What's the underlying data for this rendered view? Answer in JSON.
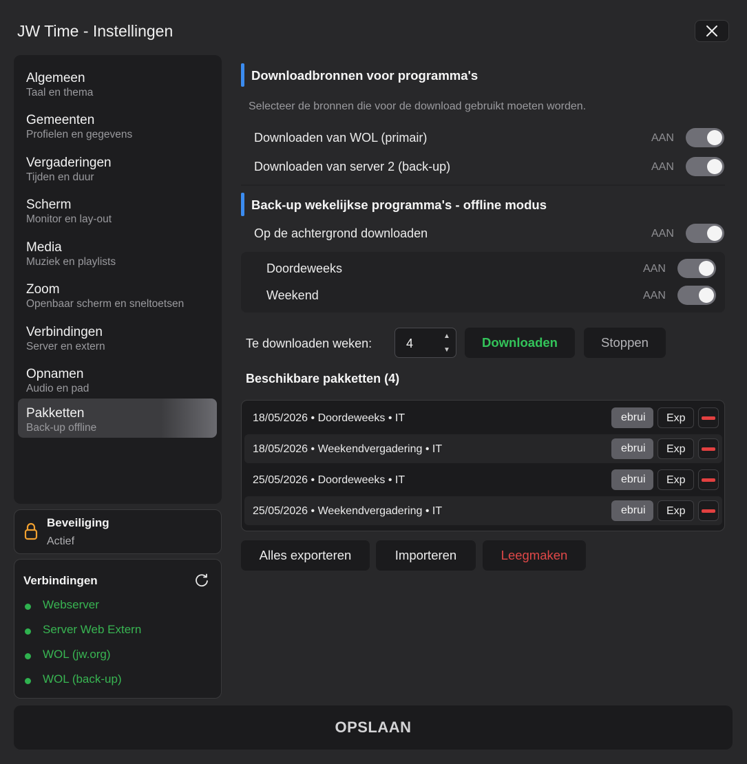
{
  "window": {
    "title": "JW Time - Instellingen",
    "close_icon": "close-icon"
  },
  "sidebar": {
    "items": [
      {
        "label": "Algemeen",
        "sub": "Taal en thema"
      },
      {
        "label": "Gemeenten",
        "sub": "Profielen en gegevens"
      },
      {
        "label": "Vergaderingen",
        "sub": "Tijden en duur"
      },
      {
        "label": "Scherm",
        "sub": "Monitor en lay-out"
      },
      {
        "label": "Media",
        "sub": "Muziek en playlists"
      },
      {
        "label": "Zoom",
        "sub": "Openbaar scherm en sneltoetsen"
      },
      {
        "label": "Verbindingen",
        "sub": "Server en extern"
      },
      {
        "label": "Opnamen",
        "sub": "Audio en pad"
      },
      {
        "label": "Pakketten",
        "sub": "Back-up offline",
        "active": true
      }
    ]
  },
  "security": {
    "title": "Beveiliging",
    "status": "Actief",
    "icon": "lock-icon"
  },
  "connections": {
    "title": "Verbindingen",
    "refresh_icon": "refresh-icon",
    "items": [
      {
        "label": "Webserver",
        "status_color": "#2fb24f"
      },
      {
        "label": "Server Web Extern",
        "status_color": "#2fb24f"
      },
      {
        "label": "WOL (jw.org)",
        "status_color": "#2fb24f"
      },
      {
        "label": "WOL (back-up)",
        "status_color": "#2fb24f"
      }
    ]
  },
  "main": {
    "sources": {
      "title": "Downloadbronnen voor programma's",
      "description": "Selecteer de bronnen die voor de download gebruikt moeten worden.",
      "rows": [
        {
          "label": "Downloaden van WOL (primair)",
          "state": "AAN",
          "on": true
        },
        {
          "label": "Downloaden van server 2 (back-up)",
          "state": "AAN",
          "on": true
        }
      ]
    },
    "offline": {
      "title": "Back-up wekelijkse programma's - offline modus",
      "background": {
        "label": "Op de achtergrond downloaden",
        "state": "AAN",
        "on": true
      },
      "sub_rows": [
        {
          "label": "Doordeweeks",
          "state": "AAN",
          "on": true
        },
        {
          "label": "Weekend",
          "state": "AAN",
          "on": true
        }
      ]
    },
    "download": {
      "weeks_label": "Te downloaden weken:",
      "weeks_value": "4",
      "download_label": "Downloaden",
      "stop_label": "Stoppen"
    },
    "packages": {
      "title": "Beschikbare pakketten (4)",
      "use_label": "ebrui",
      "export_label": "Exp",
      "rows": [
        {
          "text": "18/05/2026 • Doordeweeks • IT"
        },
        {
          "text": "18/05/2026 • Weekendvergadering • IT"
        },
        {
          "text": "25/05/2026 • Doordeweeks • IT"
        },
        {
          "text": "25/05/2026 • Weekendvergadering • IT"
        }
      ]
    },
    "actions": {
      "export_all": "Alles exporteren",
      "import": "Importeren",
      "clear": "Leegmaken"
    }
  },
  "footer": {
    "save_label": "OPSLAAN"
  },
  "colors": {
    "accent": "#3b8cf0",
    "success": "#2fb24f",
    "danger": "#e24040",
    "toggle_on": "#6f6f76"
  }
}
